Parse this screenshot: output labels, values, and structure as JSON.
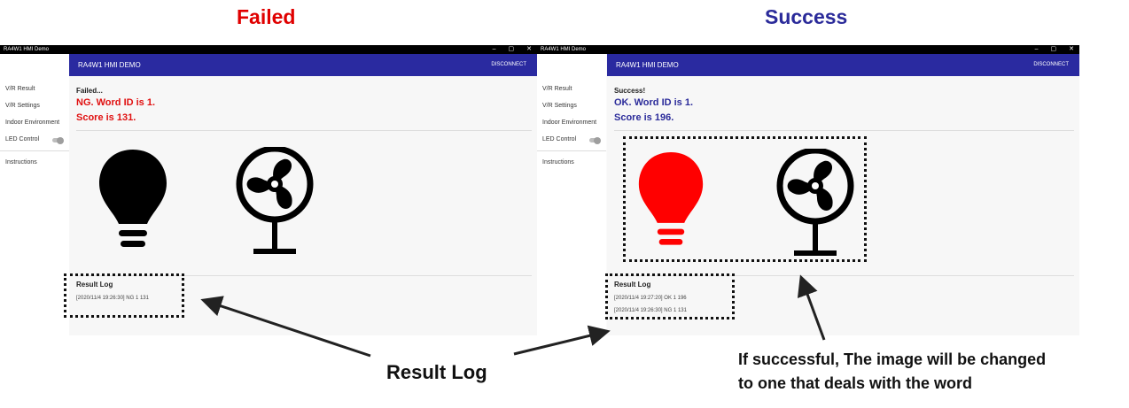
{
  "headings": {
    "failed": "Failed",
    "success": "Success"
  },
  "window_title": "RA4W1 HMI Demo",
  "app_title": "RA4W1 HMI DEMO",
  "disconnect_label": "DISCONNECT",
  "nav": {
    "vr_result": "V/R Result",
    "vr_settings": "V/R Settings",
    "indoor_environment": "Indoor Environment",
    "led_control": "LED Control",
    "instructions": "Instructions"
  },
  "failed_panel": {
    "status": "Failed...",
    "word_line": "NG. Word ID is 1.",
    "score_line": "Score is 131.",
    "result_log_title": "Result Log",
    "log": [
      "[2020/11/4 19:26:30] NG 1 131"
    ],
    "bulb_color": "#000000"
  },
  "success_panel": {
    "status": "Success!",
    "word_line": "OK. Word ID is 1.",
    "score_line": "Score is 196.",
    "result_log_title": "Result Log",
    "log": [
      "[2020/11/4 19:27:20] OK 1 196",
      "[2020/11/4 19:26:30] NG 1 131"
    ],
    "bulb_color": "#ff0000"
  },
  "annotations": {
    "result_log": "Result Log",
    "success_note_line1": "If successful, The image will be changed",
    "success_note_line2": "to one that deals with the word"
  }
}
